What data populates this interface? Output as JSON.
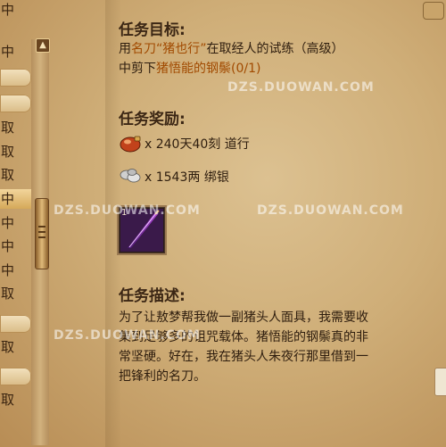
{
  "left_list": {
    "items": [
      {
        "label": "中"
      },
      {
        "label": "中"
      },
      {
        "label": ""
      },
      {
        "label": ""
      },
      {
        "label": "取"
      },
      {
        "label": "取"
      },
      {
        "label": "取"
      },
      {
        "label": "中"
      },
      {
        "label": "中"
      },
      {
        "label": "中"
      },
      {
        "label": "中"
      },
      {
        "label": "取"
      },
      {
        "label": ""
      },
      {
        "label": "取"
      },
      {
        "label": ""
      },
      {
        "label": "取"
      }
    ]
  },
  "quest": {
    "objective_title": "任务目标:",
    "objective_line1_pre": "用",
    "objective_line1_item": "名刀“猪也行”",
    "objective_line1_post": "在取经人的试练（高级）",
    "objective_line2_pre": "中剪下",
    "objective_line2_target": "猪悟能的钢鬃",
    "objective_line2_progress": "(0/1)",
    "reward_title": "任务奖励:",
    "rewards": [
      {
        "icon": "daoxing-gourd-icon",
        "text": "x 240天40刻 道行"
      },
      {
        "icon": "silver-ingot-icon",
        "text": "x 1543两 绑银"
      }
    ],
    "item_slot_count": "1",
    "desc_title": "任务描述:",
    "description": [
      "为了让敖梦帮我做一副猪头人面具，我需要收",
      "集到足够多的诅咒载体。猪悟能的钢鬃真的非",
      "常坚硬。好在，我在猪头人朱夜行那里借到一",
      "把锋利的名刀。"
    ]
  },
  "watermarks": {
    "url1": "DZS.DUOWAN.COM",
    "url2": "DZS.DUOWAN.COM",
    "url3": "DZS.DUOWAN.COM",
    "url4": "DZS.DUOWAN.COM"
  },
  "colors": {
    "highlight": "#a14a00",
    "text": "#2e1d0e"
  }
}
